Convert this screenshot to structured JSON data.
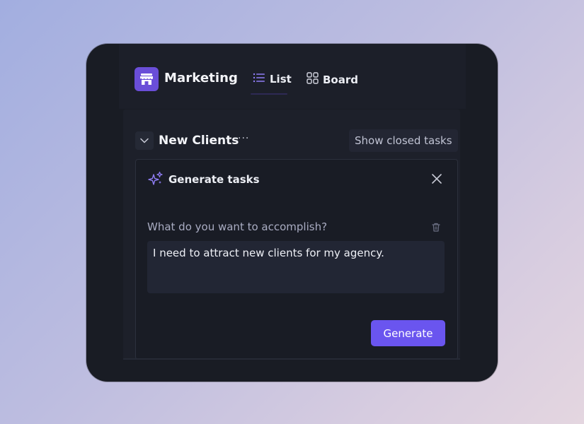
{
  "app": {
    "title": "Marketing"
  },
  "tabs": [
    {
      "label": "List",
      "icon": "list-icon",
      "active": true
    },
    {
      "label": "Board",
      "icon": "grid-icon",
      "active": false
    }
  ],
  "group": {
    "title": "New Clients",
    "more_label": "···",
    "show_closed_label": "Show closed tasks"
  },
  "generate_card": {
    "title": "Generate tasks",
    "prompt_label": "What do you want to accomplish?",
    "prompt_value": "I need to attract new clients for my agency.",
    "submit_label": "Generate"
  },
  "colors": {
    "accent": "#6a55ef",
    "app_icon_bg": "#6a4ed8",
    "window_bg": "#191c24"
  }
}
